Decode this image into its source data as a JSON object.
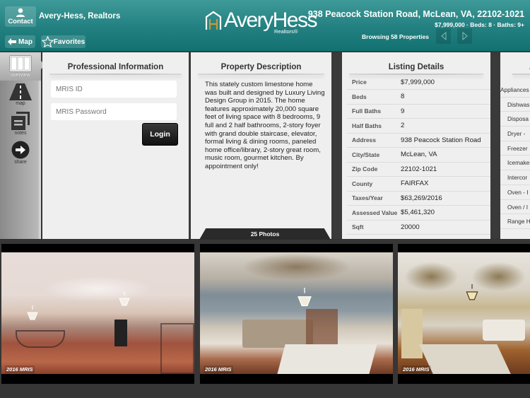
{
  "header": {
    "contact_label": "Contact",
    "agent_name": "Avery-Hess, Realtors",
    "map_label": "Map",
    "favorites_label": "Favorites",
    "logo_text": "AveryHess",
    "logo_sub": "Realtors®",
    "address": "938 Peacock Station Road, McLean, VA, 22102-1021",
    "summary": "$7,999,000 · Beds: 8 · Baths: 9+",
    "browsing": "Browsing 58 Properties",
    "prev_label": "Previous",
    "next_label": "Next",
    "colors": {
      "bar_top": "#3e9a98",
      "bar_bottom": "#137171",
      "logo_accent": "#c79a3c"
    }
  },
  "sidebar": {
    "items": [
      {
        "label": "overview",
        "icon": "overview-icon",
        "active": true
      },
      {
        "label": "map",
        "icon": "road-icon",
        "active": false
      },
      {
        "label": "notes",
        "icon": "notes-icon",
        "active": false
      },
      {
        "label": "share",
        "icon": "share-arrow-icon",
        "active": false
      }
    ]
  },
  "professional": {
    "title": "Professional Information",
    "id_placeholder": "MRIS ID",
    "password_placeholder": "MRIS Password",
    "login_label": "Login"
  },
  "description": {
    "title": "Property Description",
    "text": "This stately custom limestone home was built and designed by Luxury Living Design Group in 2015. The home features approximately 20,000 square feet of living space with 8 bedrooms, 9 full and 2 half bathrooms, 2-story foyer with grand double staircase, elevator, formal living & dining rooms, paneled home office/library, 2-story great room, music room, gourmet kitchen. By appointment only!"
  },
  "listing": {
    "title": "Listing Details",
    "rows": [
      {
        "key": "Price",
        "value": "$7,999,000"
      },
      {
        "key": "Beds",
        "value": "8"
      },
      {
        "key": "Full Baths",
        "value": "9"
      },
      {
        "key": "Half Baths",
        "value": "2"
      },
      {
        "key": "Address",
        "value": "938 Peacock Station Road"
      },
      {
        "key": "City/State",
        "value": "McLean, VA"
      },
      {
        "key": "Zip Code",
        "value": "22102-1021"
      },
      {
        "key": "County",
        "value": "FAIRFAX"
      },
      {
        "key": "Taxes/Year",
        "value": "$63,269/2016"
      },
      {
        "key": "Assessed Value",
        "value": "$5,461,320"
      },
      {
        "key": "Sqft",
        "value": "20000"
      }
    ]
  },
  "features": {
    "title": "A",
    "heading": "Appliances",
    "items": [
      "Dishwas",
      "Disposa",
      "Dryer -",
      "Freezer",
      "Icemake",
      "Intercor",
      "Oven - I",
      "Oven / I",
      "Range H"
    ]
  },
  "photos": {
    "tab_label": "25 Photos",
    "items": [
      {
        "watermark": "2016 MRIS"
      },
      {
        "watermark": "2016 MRIS"
      },
      {
        "watermark": "2016 MRIS"
      }
    ]
  }
}
